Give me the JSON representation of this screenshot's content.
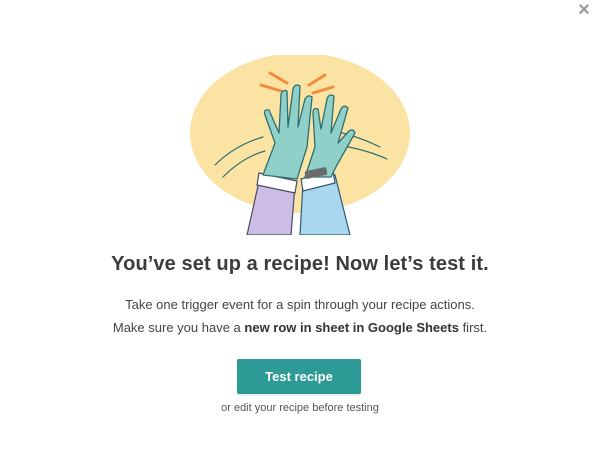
{
  "modal": {
    "close_icon": "×",
    "title": "You’ve set up a recipe! Now let’s test it.",
    "description_line1": "Take one trigger event for a spin through your recipe actions.",
    "description_line2_prefix": "Make sure you have a ",
    "description_line2_bold": "new row in sheet in Google Sheets",
    "description_line2_suffix": " first.",
    "test_button_label": "Test recipe",
    "edit_link_label": "or edit your recipe before testing"
  },
  "illustration": {
    "icon": "high-five-illustration",
    "colors": {
      "background_ellipse": "#fbe3a3",
      "glove": "#8fd1c9",
      "glove_outline": "#2f6e70",
      "left_sleeve": "#cbbde4",
      "right_sleeve": "#a9d7ee",
      "spark": "#f28c3c"
    }
  },
  "colors": {
    "accent": "#2d9a96",
    "title": "#3c3c3c",
    "text": "#444444"
  }
}
